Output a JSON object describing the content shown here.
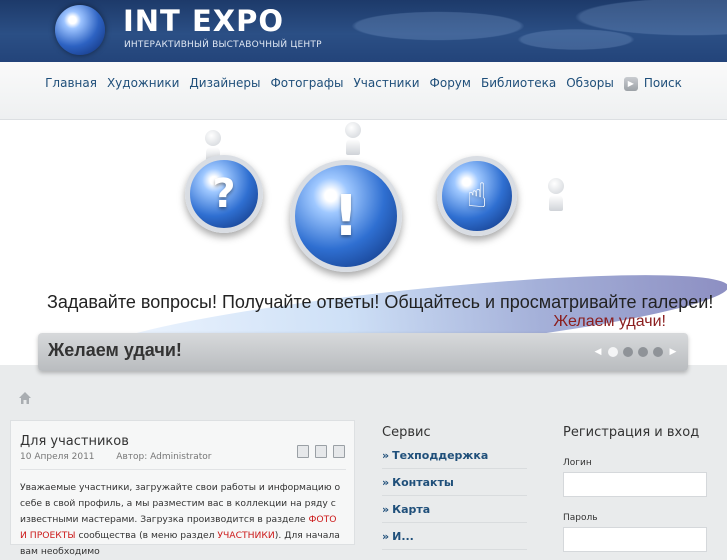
{
  "header": {
    "logo_title": "INT EXPO",
    "logo_subtitle": "ИНТЕРАКТИВНЫЙ ВЫСТАВОЧНЫЙ ЦЕНТР"
  },
  "nav": {
    "items": [
      "Главная",
      "Художники",
      "Дизайнеры",
      "Фотографы",
      "Участники",
      "Форум",
      "Библиотека",
      "Обзоры"
    ],
    "search_label": "Поиск"
  },
  "banner": {
    "orb_symbols": [
      "?",
      "!",
      "☝"
    ],
    "line1": "Задавайте вопросы! Получайте ответы! Общайтесь и просматривайте галереи!",
    "line2": "Желаем удачи!"
  },
  "slider": {
    "caption": "Желаем удачи!",
    "prev_symbol": "◀",
    "next_symbol": "▶",
    "dots": 4,
    "active_dot": 1
  },
  "article": {
    "title": "Для участников",
    "date": "10 Апреля 2011",
    "author": "Автор: Administrator",
    "body_p1": "Уважаемые участники, загружайте свои работы и информацию о себе в свой профиль, а мы разместим вас в коллекции на ряду с известными мастерами. Загрузка производится в разделе ",
    "link1": "ФОТО И ПРОЕКТЫ",
    "body_p2": " сообщества (в меню раздел ",
    "link2": "УЧАСТНИКИ",
    "body_p3": "). Для начала вам необходимо"
  },
  "service": {
    "title": "Сервис",
    "items": [
      "Техподдержка",
      "Контакты",
      "Карта",
      "И..."
    ]
  },
  "login": {
    "title": "Регистрация и вход",
    "login_label": "Логин",
    "password_label": "Пароль",
    "login_value": "",
    "password_value": ""
  },
  "colors": {
    "header_bg": "#23447a",
    "nav_link": "#1f4f7a",
    "accent_red": "#cc1a1a",
    "banner_red": "#8b1e1e"
  }
}
